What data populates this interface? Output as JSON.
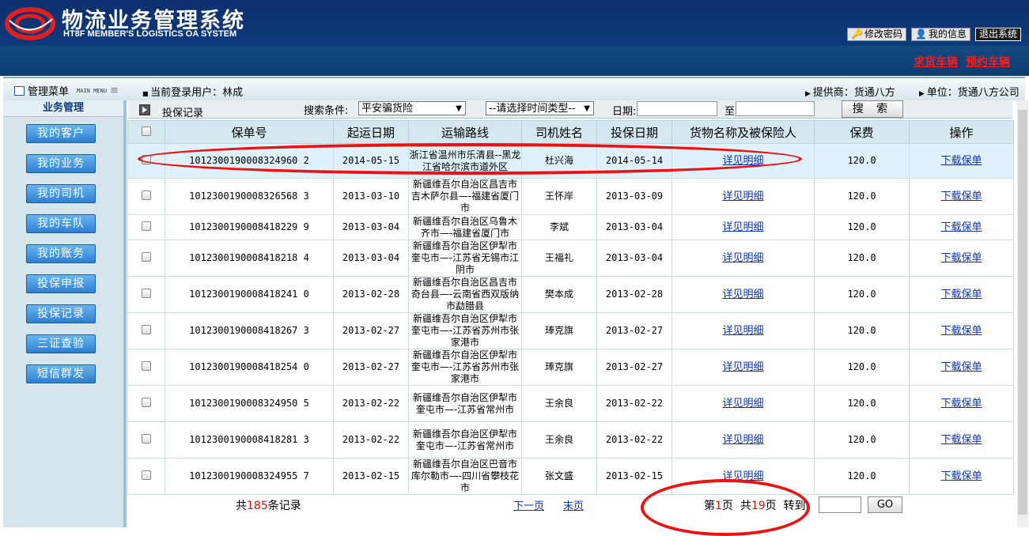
{
  "header": {
    "title": "物流业务管理系统",
    "subtitle": "HT8F MEMBER'S LOGISTICS OA SYSTEM",
    "buttons": {
      "change_password": "修改密码",
      "my_info": "我的信息",
      "logout": "退出系统"
    },
    "links": {
      "find_goods": "求货车辆",
      "reserve": "预约车辆"
    }
  },
  "menubar": {
    "title": "管理菜单",
    "mini": "MAIN MENU",
    "current_user": "当前登录用户：林成",
    "provider": "提供商：货通八方",
    "unit": "单位：货通八方公司"
  },
  "sidebar": {
    "heading": "业务管理",
    "items": [
      "我的客户",
      "我的业务",
      "我的司机",
      "我的车队",
      "我的账务",
      "投保申报",
      "投保记录",
      "三证查验",
      "短信群发"
    ]
  },
  "toolbar": {
    "title": "投保记录",
    "condition_label": "搜索条件:",
    "condition_value": "平安骗货险",
    "time_type": "--请选择时间类型--",
    "date_label": "日期:",
    "to_label": "至",
    "search": "搜 索"
  },
  "table": {
    "headers": [
      "保单号",
      "起运日期",
      "运输路线",
      "司机姓名",
      "投保日期",
      "货物名称及被保险人",
      "保费",
      "操作"
    ],
    "rows": [
      {
        "policy": "1012300190008324960 2",
        "start": "2014-05-15",
        "route": "浙江省温州市乐清县--黑龙江省哈尔滨市道外区",
        "driver": "杜兴海",
        "insure": "2014-05-14",
        "detail": "详见明细",
        "fee": "120.0",
        "op": "下载保单"
      },
      {
        "policy": "1012300190008326568 3",
        "start": "2013-03-10",
        "route": "新疆维吾尔自治区昌吉市吉木萨尔县—-福建省厦门市",
        "driver": "王怀岸",
        "insure": "2013-03-09",
        "detail": "详见明细",
        "fee": "120.0",
        "op": "下载保单"
      },
      {
        "policy": "1012300190008418229 9",
        "start": "2013-03-04",
        "route": "新疆维吾尔自治区乌鲁木齐市—-福建省厦门市",
        "driver": "李斌",
        "insure": "2013-03-04",
        "detail": "详见明细",
        "fee": "120.0",
        "op": "下载保单"
      },
      {
        "policy": "1012300190008418218 4",
        "start": "2013-03-04",
        "route": "新疆维吾尔自治区伊犁市奎屯市—-江苏省无锡市江阴市",
        "driver": "王福礼",
        "insure": "2013-03-04",
        "detail": "详见明细",
        "fee": "120.0",
        "op": "下载保单"
      },
      {
        "policy": "1012300190008418241 0",
        "start": "2013-02-28",
        "route": "新疆维吾尔自治区昌吉市奇台县—-云南省西双版纳市勐腊县",
        "driver": "樊本成",
        "insure": "2013-02-28",
        "detail": "详见明细",
        "fee": "120.0",
        "op": "下载保单"
      },
      {
        "policy": "1012300190008418267 3",
        "start": "2013-02-27",
        "route": "新疆维吾尔自治区伊犁市奎屯市—-江苏省苏州市张家港市",
        "driver": "琫克旗",
        "insure": "2013-02-27",
        "detail": "详见明细",
        "fee": "120.0",
        "op": "下载保单"
      },
      {
        "policy": "1012300190008418254 0",
        "start": "2013-02-27",
        "route": "新疆维吾尔自治区伊犁市奎屯市—-江苏省苏州市张家港市",
        "driver": "琫克旗",
        "insure": "2013-02-27",
        "detail": "详见明细",
        "fee": "120.0",
        "op": "下载保单"
      },
      {
        "policy": "1012300190008324950 5",
        "start": "2013-02-22",
        "route": "新疆维吾尔自治区伊犁市奎屯市—-江苏省常州市",
        "driver": "王余良",
        "insure": "2013-02-22",
        "detail": "详见明细",
        "fee": "120.0",
        "op": "下载保单"
      },
      {
        "policy": "1012300190008418281 3",
        "start": "2013-02-22",
        "route": "新疆维吾尔自治区伊犁市奎屯市—-江苏省常州市",
        "driver": "王余良",
        "insure": "2013-02-22",
        "detail": "详见明细",
        "fee": "120.0",
        "op": "下载保单"
      },
      {
        "policy": "1012300190008324955 7",
        "start": "2013-02-15",
        "route": "新疆维吾尔自治区巴音市库尔勒市—-四川省攀枝花市",
        "driver": "张文盛",
        "insure": "2013-02-15",
        "detail": "详见明细",
        "fee": "120.0",
        "op": "下载保单"
      }
    ]
  },
  "pager": {
    "total_prefix": "共",
    "total": "185",
    "total_suffix": "条记录",
    "next": "下一页",
    "last": "末页",
    "page_prefix": "第",
    "page": "1",
    "page_mid": "页  共",
    "pages": "19",
    "page_suffix": "页  转到",
    "go": "GO"
  }
}
